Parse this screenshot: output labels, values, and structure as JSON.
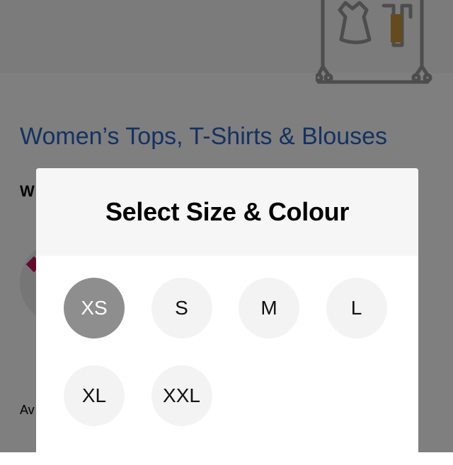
{
  "background": {
    "category_title": "Women’s Tops, T-Shirts & Blouses",
    "section_heading": "W",
    "availability_label": "Av",
    "banner_icon": "wardrobe-icon"
  },
  "modal": {
    "title": "Select Size & Colour",
    "sizes": [
      {
        "label": "XS",
        "selected": true
      },
      {
        "label": "S",
        "selected": false
      },
      {
        "label": "M",
        "selected": false
      },
      {
        "label": "L",
        "selected": false
      },
      {
        "label": "XL",
        "selected": false
      },
      {
        "label": "XXL",
        "selected": false
      }
    ]
  },
  "colors": {
    "accent_link": "#2a63c4",
    "selected_size_bg": "#8e8e8e",
    "unselected_size_bg": "#f3f3f3"
  }
}
